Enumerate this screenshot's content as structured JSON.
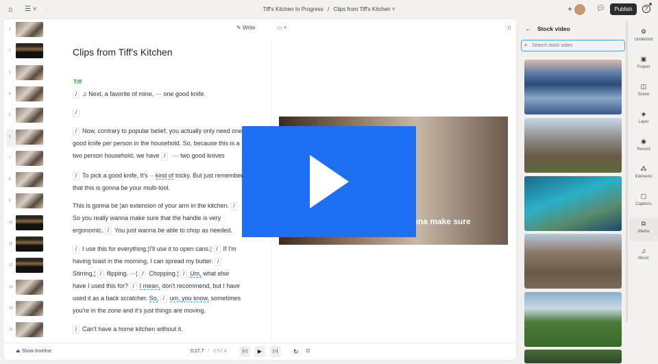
{
  "topbar": {
    "project": "Tiff's Kitchen In Progress",
    "separator": "/",
    "composition": "Clips from Tiff's Kitchen",
    "publish": "Publish"
  },
  "editor": {
    "write": "Write",
    "title": "Clips from Tiff's Kitchen",
    "speaker": "Tiff",
    "thumb_numbers": [
      "1",
      "2",
      "3",
      "4",
      "5",
      "6",
      "7",
      "8",
      "9",
      "10",
      "11",
      "12",
      "13",
      "14",
      "15"
    ],
    "p1": "Next, a favorite of mine,",
    "p1b": "one good knife.",
    "p3a": "Now, contrary to popular belief, you actually only need one good knife per person in the household. So, because this is a two person household, we have",
    "p3b": "two good knives",
    "p4a": "To pick a good knife, It's",
    "p4u": "kind of",
    "p4b": "tricky. But just remember that this is gonna be your multi-tool.",
    "p5a": "This is gonna be",
    "p5b": "an extension of your arm in the kitchen.",
    "p5c": "So you really wanna make sure that the handle is very ergonomic.",
    "p5d": "You just wanna be able to chop as needed.",
    "p6a": "I use this for everything.",
    "p6b": "I'll use it to open cans.",
    "p6c": "If I'm having toast in the morning, I can spread my butter.",
    "p6d": "Stirring,",
    "p6e": "flipping.",
    "p6f": "Chopping.",
    "p6g": "Um,",
    "p6h": "what else have I used this for?",
    "p6i": "I mean,",
    "p6j": "don't recommend, but I have used it as a back scratcher.",
    "p6k": "So,",
    "p6l": "um, you know,",
    "p6m": "sometimes you're in the zone and it's just things are moving.",
    "p7": "Can't have a home kitchen without it."
  },
  "video": {
    "caption": "you really wanna make sure"
  },
  "bottom": {
    "show_timeline": "Show timeline",
    "current": "0:27.7",
    "sep": "/",
    "total": "0:57.4"
  },
  "stock": {
    "title": "Stock video",
    "placeholder": "Search stock video"
  },
  "sidebar": [
    "Underlord",
    "Project",
    "Scene",
    "Layer",
    "Record",
    "Elements",
    "Captions",
    "Media",
    "Music"
  ],
  "colors": {
    "accent": "#1f6ff2",
    "speaker": "#2e9a3a"
  }
}
